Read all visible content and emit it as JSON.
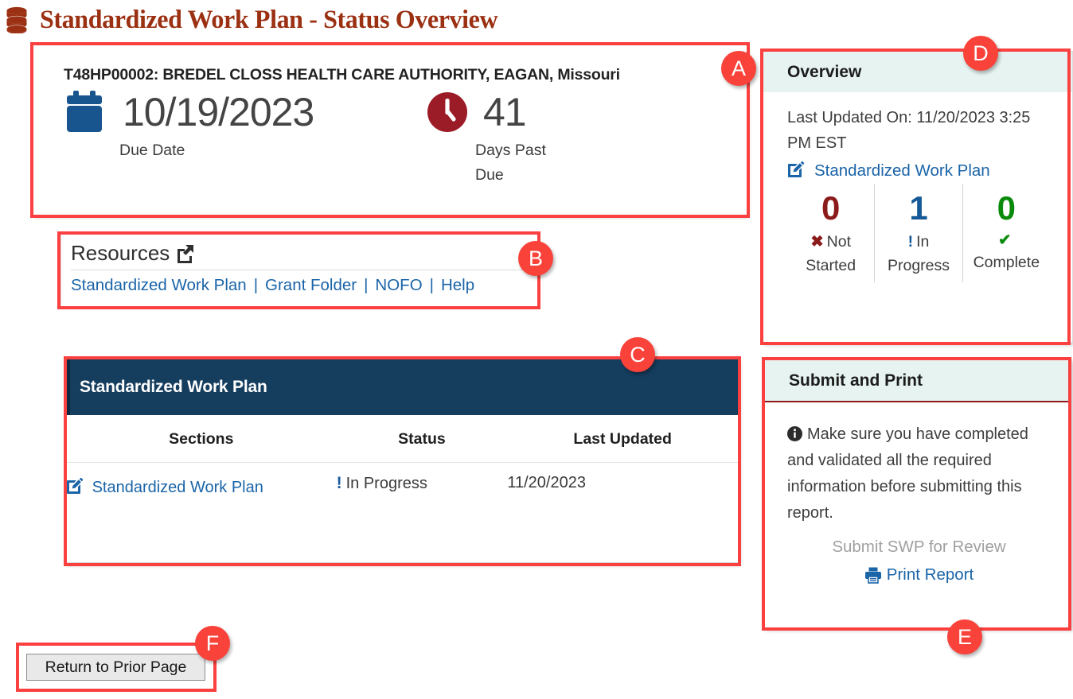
{
  "header": {
    "title": "Standardized Work Plan - Status Overview",
    "icon": "database-icon",
    "title_color": "#9b3012"
  },
  "summary": {
    "grant_title": "T48HP00002: BREDEL CLOSS HEALTH CARE AUTHORITY, EAGAN, Missouri",
    "due_date": {
      "icon": "calendar-icon",
      "value": "10/19/2023",
      "label": "Due Date",
      "icon_color": "#18558f"
    },
    "days_past_due": {
      "icon": "clock-icon",
      "value": "41",
      "label": "Days Past Due",
      "icon_color": "#9b1b26"
    }
  },
  "resources": {
    "title": "Resources",
    "icon": "external-link-icon",
    "links": [
      {
        "label": "Standardized Work Plan"
      },
      {
        "label": "Grant Folder"
      },
      {
        "label": "NOFO"
      },
      {
        "label": "Help"
      }
    ],
    "separator": "|",
    "link_color": "#1a64a8"
  },
  "work_plan_table": {
    "header": "Standardized Work Plan",
    "header_bg": "#153d5e",
    "columns": [
      "Sections",
      "Status",
      "Last Updated"
    ],
    "rows": [
      {
        "section": "Standardized Work Plan",
        "section_icon": "edit-pencil-square-icon",
        "status": "In Progress",
        "status_icon": "exclamation-icon",
        "status_icon_color": "#1a5c9e",
        "last_updated": "11/20/2023"
      }
    ]
  },
  "overview": {
    "title": "Overview",
    "last_updated": "Last Updated On: 11/20/2023 3:25 PM EST",
    "link": {
      "label": "Standardized Work Plan",
      "icon": "edit-pencil-square-icon"
    },
    "counters": [
      {
        "count": "0",
        "label": "Not Started",
        "icon": "x-mark-icon",
        "color": "#8b1a1a"
      },
      {
        "count": "1",
        "label": "In Progress",
        "icon": "exclamation-icon",
        "color": "#155a96"
      },
      {
        "count": "0",
        "label": "Complete",
        "icon": "check-mark-icon",
        "color": "#0a8a0a"
      }
    ]
  },
  "submit_and_print": {
    "title": "Submit and Print",
    "info_icon": "info-circle-icon",
    "note": "Make sure you have completed and validated all the required information before submitting this report.",
    "submit_label": "Submit SWP for Review",
    "submit_disabled": true,
    "print_label": "Print Report",
    "print_icon": "printer-icon"
  },
  "footer": {
    "return_button": "Return to Prior Page"
  },
  "annotations": [
    {
      "letter": "A"
    },
    {
      "letter": "B"
    },
    {
      "letter": "C"
    },
    {
      "letter": "D"
    },
    {
      "letter": "E"
    },
    {
      "letter": "F"
    }
  ]
}
